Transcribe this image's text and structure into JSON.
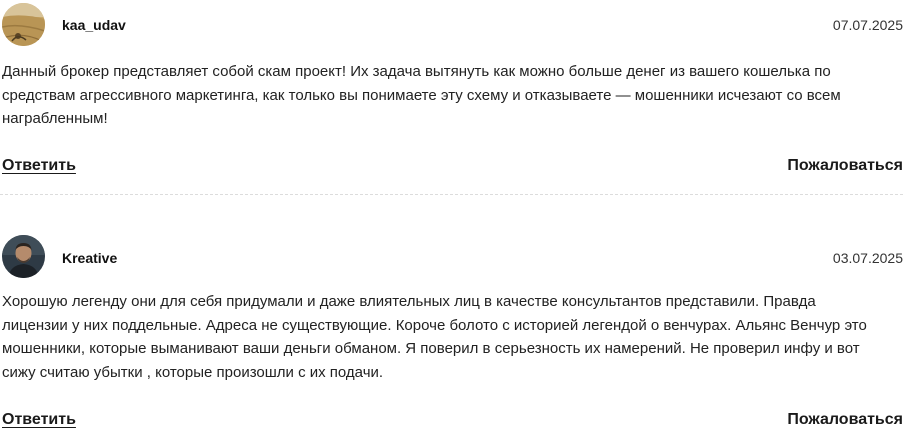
{
  "comments": [
    {
      "username": "kaa_udav",
      "date": "07.07.2025",
      "avatar_icon": "desert-avatar-icon",
      "text": "Данный брокер представляет собой скам проект! Их задача вытянуть как можно больше денег из вашего кошелька по средствам агрессивного маркетинга, как только вы понимаете эту схему и отказываете — мошенники исчезают со всем награбленным!",
      "reply_label": "Ответить",
      "report_label": "Пожаловаться"
    },
    {
      "username": "Kreative",
      "date": "03.07.2025",
      "avatar_icon": "person-avatar-icon",
      "text": "Хорошую легенду они для себя придумали и даже влиятельных лиц в качестве консультантов представили. Правда лицензии у них поддельные. Адреса не существующие. Короче болото с историей легендой о венчурах. Альянс Венчур это мошенники, которые выманивают ваши деньги обманом. Я поверил в серьезность их намерений. Не проверил инфу и вот сижу считаю убытки , которые произошли с их подачи.",
      "reply_label": "Ответить",
      "report_label": "Пожаловаться"
    }
  ]
}
